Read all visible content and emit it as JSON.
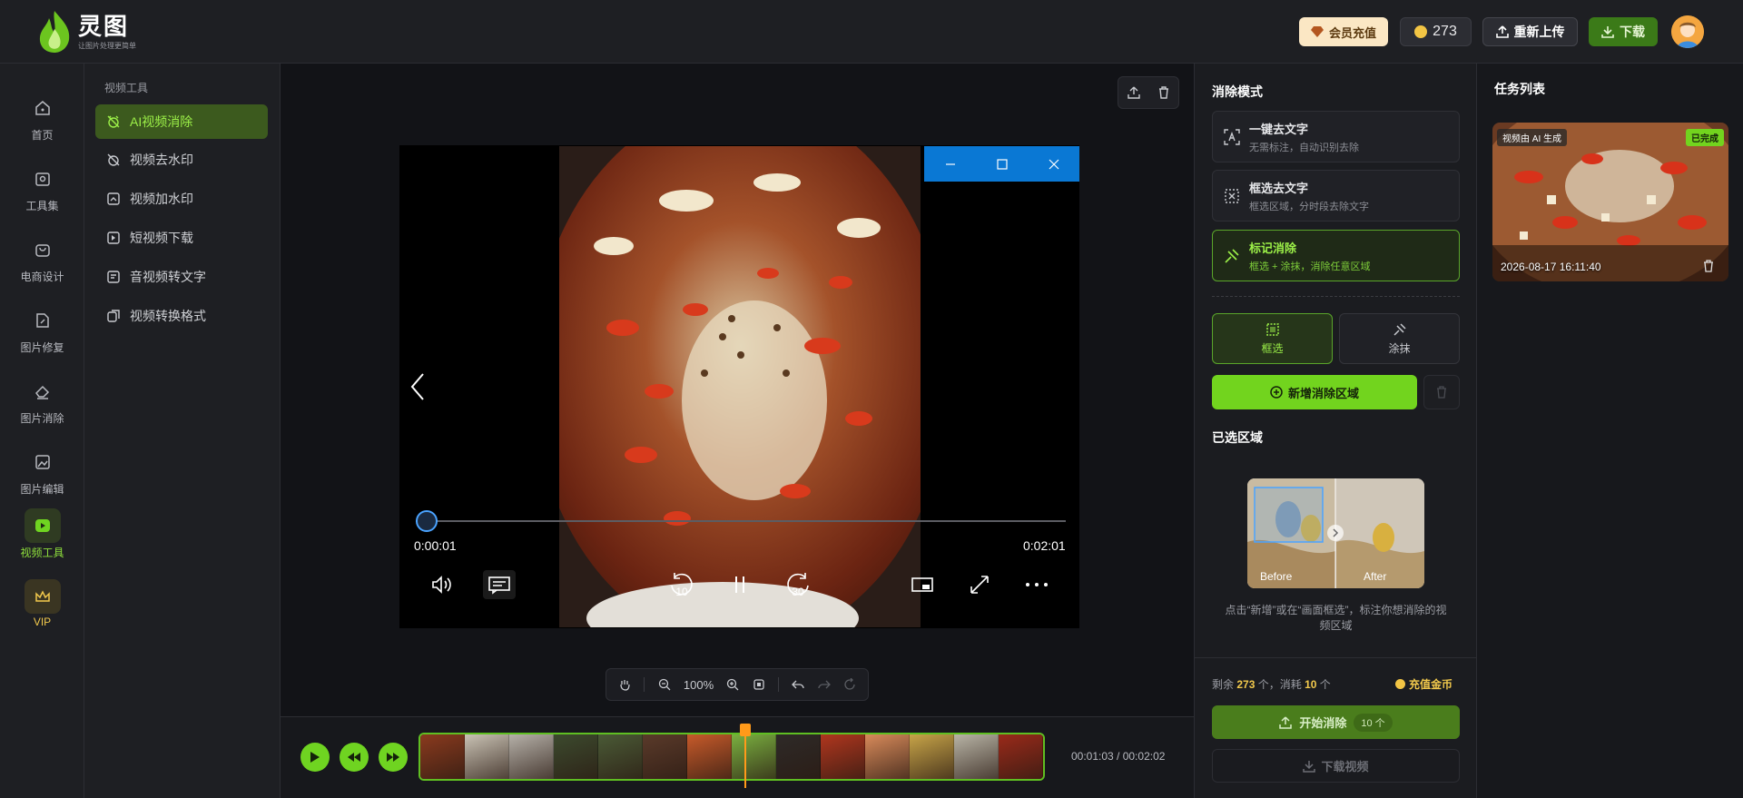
{
  "header": {
    "logo_title": "灵图",
    "logo_sub": "让图片处理更简单",
    "vip_label": "会员充值",
    "coins": "273",
    "reupload_label": "重新上传",
    "download_label": "下载"
  },
  "rail": {
    "items": [
      {
        "label": "首页",
        "icon": "home-icon"
      },
      {
        "label": "工具集",
        "icon": "toolbox-icon"
      },
      {
        "label": "电商设计",
        "icon": "shopping-bag-icon"
      },
      {
        "label": "图片修复",
        "icon": "image-repair-icon"
      },
      {
        "label": "图片消除",
        "icon": "eraser-icon"
      },
      {
        "label": "图片编辑",
        "icon": "image-edit-icon"
      },
      {
        "label": "视频工具",
        "icon": "video-icon"
      },
      {
        "label": "VIP",
        "icon": "crown-icon"
      }
    ]
  },
  "subnav": {
    "heading": "视频工具",
    "items": [
      {
        "label": "AI视频消除",
        "icon": "ai-erase-icon"
      },
      {
        "label": "视频去水印",
        "icon": "watermark-remove-icon"
      },
      {
        "label": "视频加水印",
        "icon": "watermark-add-icon"
      },
      {
        "label": "短视频下载",
        "icon": "video-download-icon"
      },
      {
        "label": "音视频转文字",
        "icon": "speech-to-text-icon"
      },
      {
        "label": "视频转换格式",
        "icon": "format-convert-icon"
      }
    ]
  },
  "player": {
    "current_time": "0:00:01",
    "total_time": "0:02:01",
    "skip_back": "10",
    "skip_forward": "30",
    "progress": 0.008
  },
  "zoom": {
    "value": "100%"
  },
  "timeline": {
    "time": "00:01:03 / 00:02:02",
    "frame_colors": [
      "#8a3a1e",
      "#c9c2b4",
      "#b5b0a8",
      "#3c4a2e",
      "#4a5a36",
      "#5a3a2a",
      "#c75a2a",
      "#7ab040",
      "#2e2a28",
      "#b0361e",
      "#d88a5a",
      "#c7a448",
      "#b8b4a6",
      "#9a2a1a"
    ]
  },
  "panel": {
    "mode_title": "消除模式",
    "modes": [
      {
        "name": "一键去文字",
        "desc": "无需标注，自动识别去除",
        "icon": "auto-text-icon"
      },
      {
        "name": "框选去文字",
        "desc": "框选区域，分时段去除文字",
        "icon": "box-text-icon"
      },
      {
        "name": "标记消除",
        "desc": "框选 + 涂抹，消除任意区域",
        "icon": "mark-erase-icon"
      }
    ],
    "tool_box": "框选",
    "tool_brush": "涂抹",
    "add_region": "新增消除区域",
    "selected_title": "已选区域",
    "demo_before": "Before",
    "demo_after": "After",
    "hint": "点击“新增”或在“画面框选”，标注你想消除的视频区域",
    "remain_prefix": "剩余",
    "remain_value": "273",
    "remain_mid": "个，消耗",
    "cost_value": "10",
    "remain_suffix": "个",
    "recharge": "充值金币",
    "start_label": "开始消除",
    "start_pill": "10 个",
    "download_video": "下载视频"
  },
  "tasks": {
    "title": "任务列表",
    "items": [
      {
        "badge_ai": "视频由 AI 生成",
        "badge_status": "已完成",
        "time": "2026-08-17 16:11:40"
      }
    ]
  },
  "colors": {
    "accent": "#72d41e",
    "accent_dark": "#3b7a18",
    "gold": "#f2c94c",
    "window_blue": "#0a78d4"
  }
}
